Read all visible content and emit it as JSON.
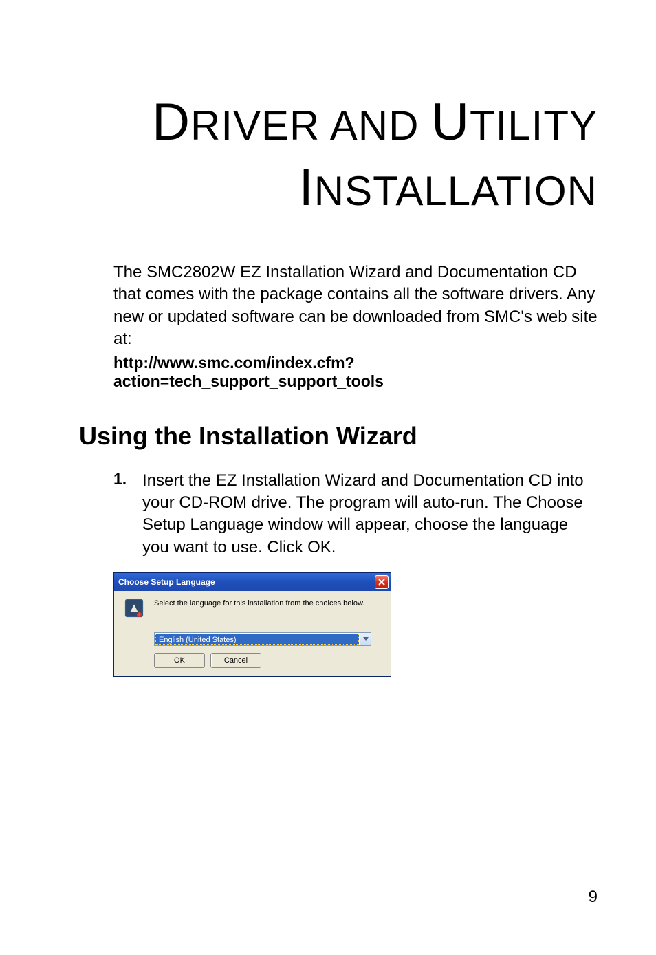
{
  "title": {
    "line1_pre": "D",
    "line1_rest": "RIVER AND ",
    "line1_pre2": "U",
    "line1_rest2": "TILITY",
    "line2_pre": "I",
    "line2_rest": "NSTALLATION"
  },
  "intro": "The SMC2802W EZ Installation Wizard and Documentation CD that comes with the package contains all the software drivers. Any new or updated software can be downloaded from SMC's web site at:",
  "url": "http://www.smc.com/index.cfm?action=tech_support_support_tools",
  "section_heading": "Using the Installation Wizard",
  "step": {
    "num": "1.",
    "text": "Insert the EZ Installation Wizard and Documentation CD into your CD-ROM drive. The program will auto-run. The Choose Setup Language window will appear, choose the language you want to use. Click OK."
  },
  "dialog": {
    "title": "Choose Setup Language",
    "instruction": "Select the language for this installation from the choices below.",
    "selected": "English (United States)",
    "ok": "OK",
    "cancel": "Cancel"
  },
  "page_number": "9"
}
